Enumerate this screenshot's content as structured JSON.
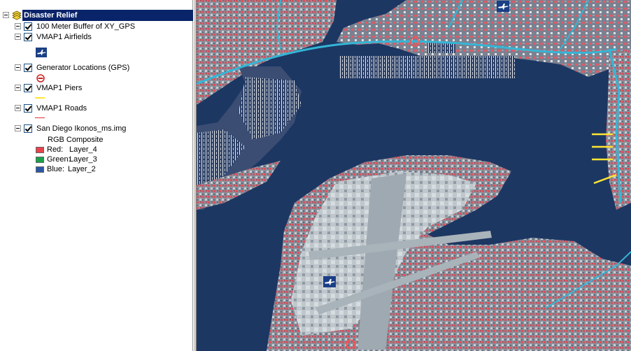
{
  "toc": {
    "root_label": "Disaster Relief",
    "layers": [
      {
        "label": "100 Meter Buffer of XY_GPS",
        "checked": true
      },
      {
        "label": "VMAP1 Airfields",
        "checked": true,
        "symbol": "airplane-icon"
      },
      {
        "label": "Generator Locations (GPS)",
        "checked": true,
        "symbol": "no-entry-icon"
      },
      {
        "label": "VMAP1 Piers",
        "checked": true,
        "symbol_color": "#ffe633"
      },
      {
        "label": "VMAP1 Roads",
        "checked": true,
        "symbol_color": "#e03030"
      },
      {
        "label": "San Diego Ikonos_ms.img",
        "checked": true
      }
    ],
    "raster": {
      "composite_label": "RGB Composite",
      "bands": [
        {
          "channel": "Red:",
          "layer": "Layer_4",
          "color": "#e8424a"
        },
        {
          "channel": "Green:",
          "layer": "Layer_3",
          "color": "#1aa14a"
        },
        {
          "channel": "Blue:",
          "layer": "Layer_2",
          "color": "#2a56a8"
        }
      ]
    }
  },
  "colors": {
    "selection": "#0a246a",
    "water": "#1d3763",
    "land": "#6f8598",
    "vegetation": "#d8505c",
    "roads": "#34b6d6",
    "piers": "#ffe633",
    "airport": "#c9d2d7"
  }
}
